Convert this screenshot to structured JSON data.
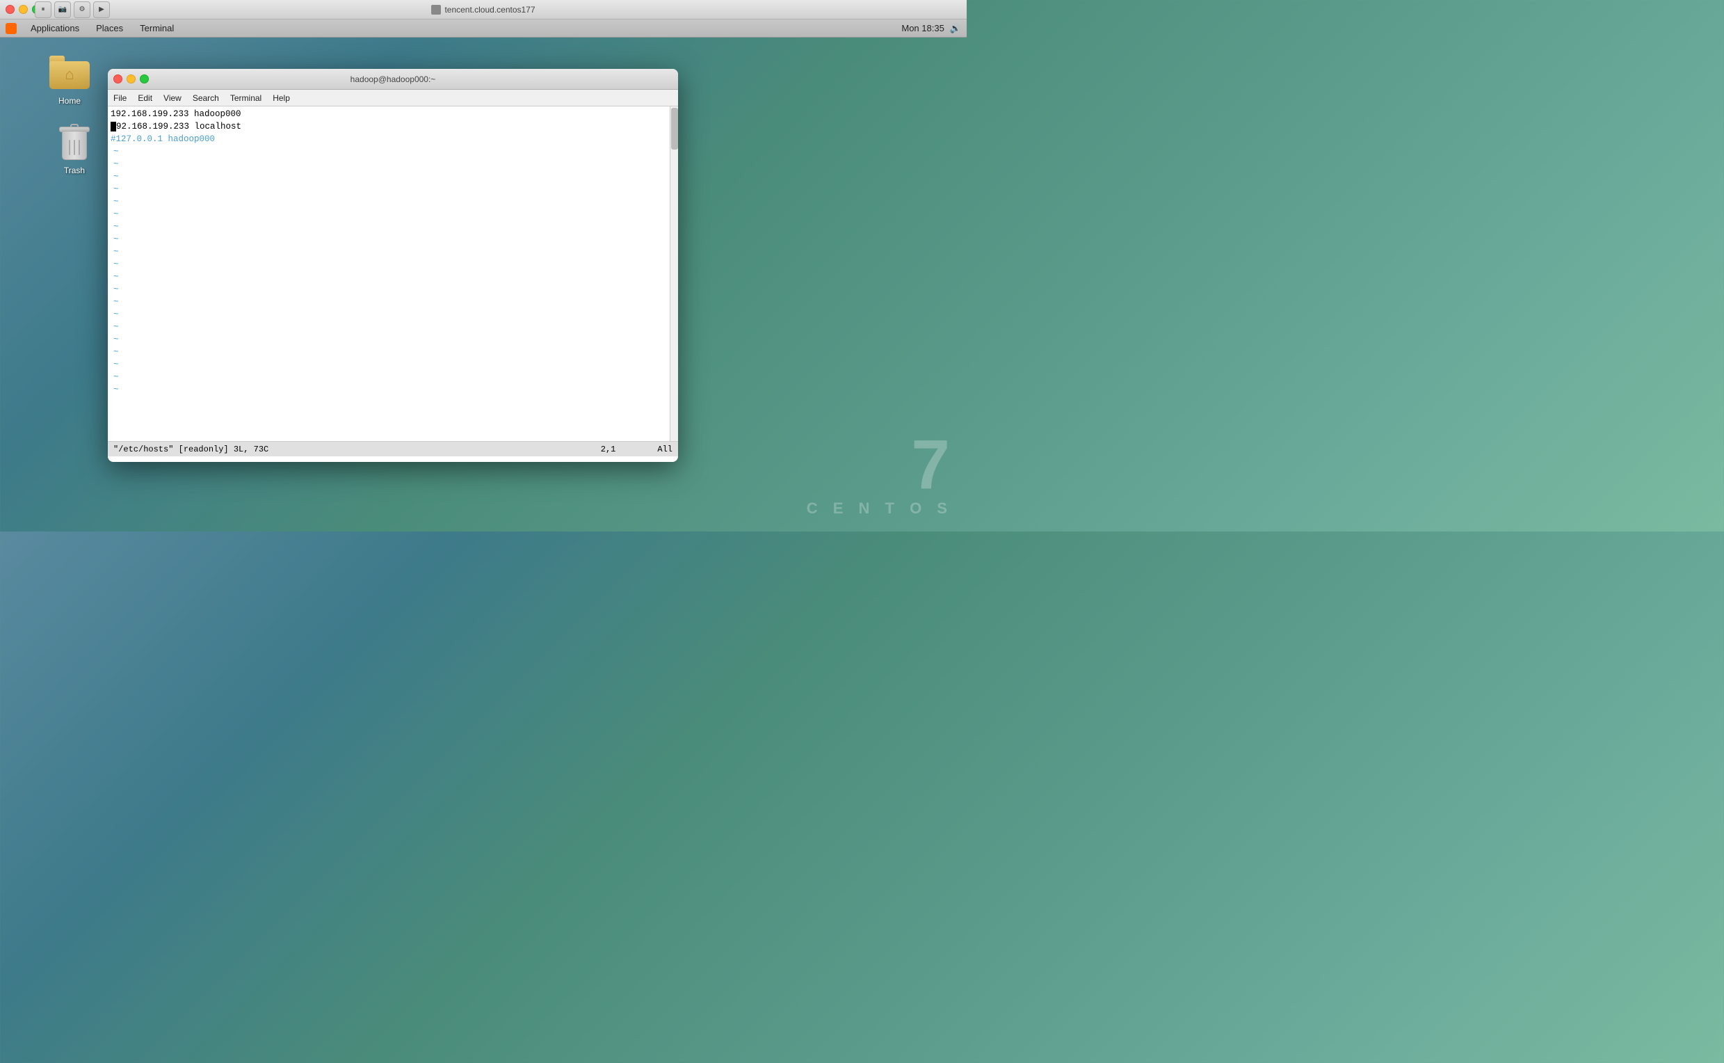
{
  "titlebar": {
    "title": "tencent.cloud.centos177",
    "buttons": {
      "close": "×",
      "minimize": "–",
      "maximize": "□"
    }
  },
  "menubar": {
    "items": [
      {
        "label": "Applications",
        "id": "applications"
      },
      {
        "label": "Places",
        "id": "places"
      },
      {
        "label": "Terminal",
        "id": "terminal"
      }
    ],
    "right": {
      "datetime": "Mon 18:35",
      "volume_icon": "🔊"
    }
  },
  "desktop": {
    "icons": [
      {
        "id": "home",
        "label": "Home"
      },
      {
        "id": "trash",
        "label": "Trash"
      }
    ],
    "watermark": {
      "number": "7",
      "text": "C E N T O S"
    }
  },
  "terminal": {
    "title": "hadoop@hadoop000:~",
    "menubar": {
      "items": [
        "File",
        "Edit",
        "View",
        "Search",
        "Terminal",
        "Help"
      ]
    },
    "content": {
      "lines": [
        {
          "type": "normal",
          "text": "192.168.199.233 hadoop000"
        },
        {
          "type": "normal",
          "text": "192.168.199.233 localhost"
        },
        {
          "type": "comment",
          "text": "#127.0.0.1 hadoop000"
        }
      ],
      "tildes": 20
    },
    "statusbar": {
      "left": "\"/etc/hosts\" [readonly] 3L, 73C",
      "middle": "2,1",
      "right": "All"
    }
  }
}
